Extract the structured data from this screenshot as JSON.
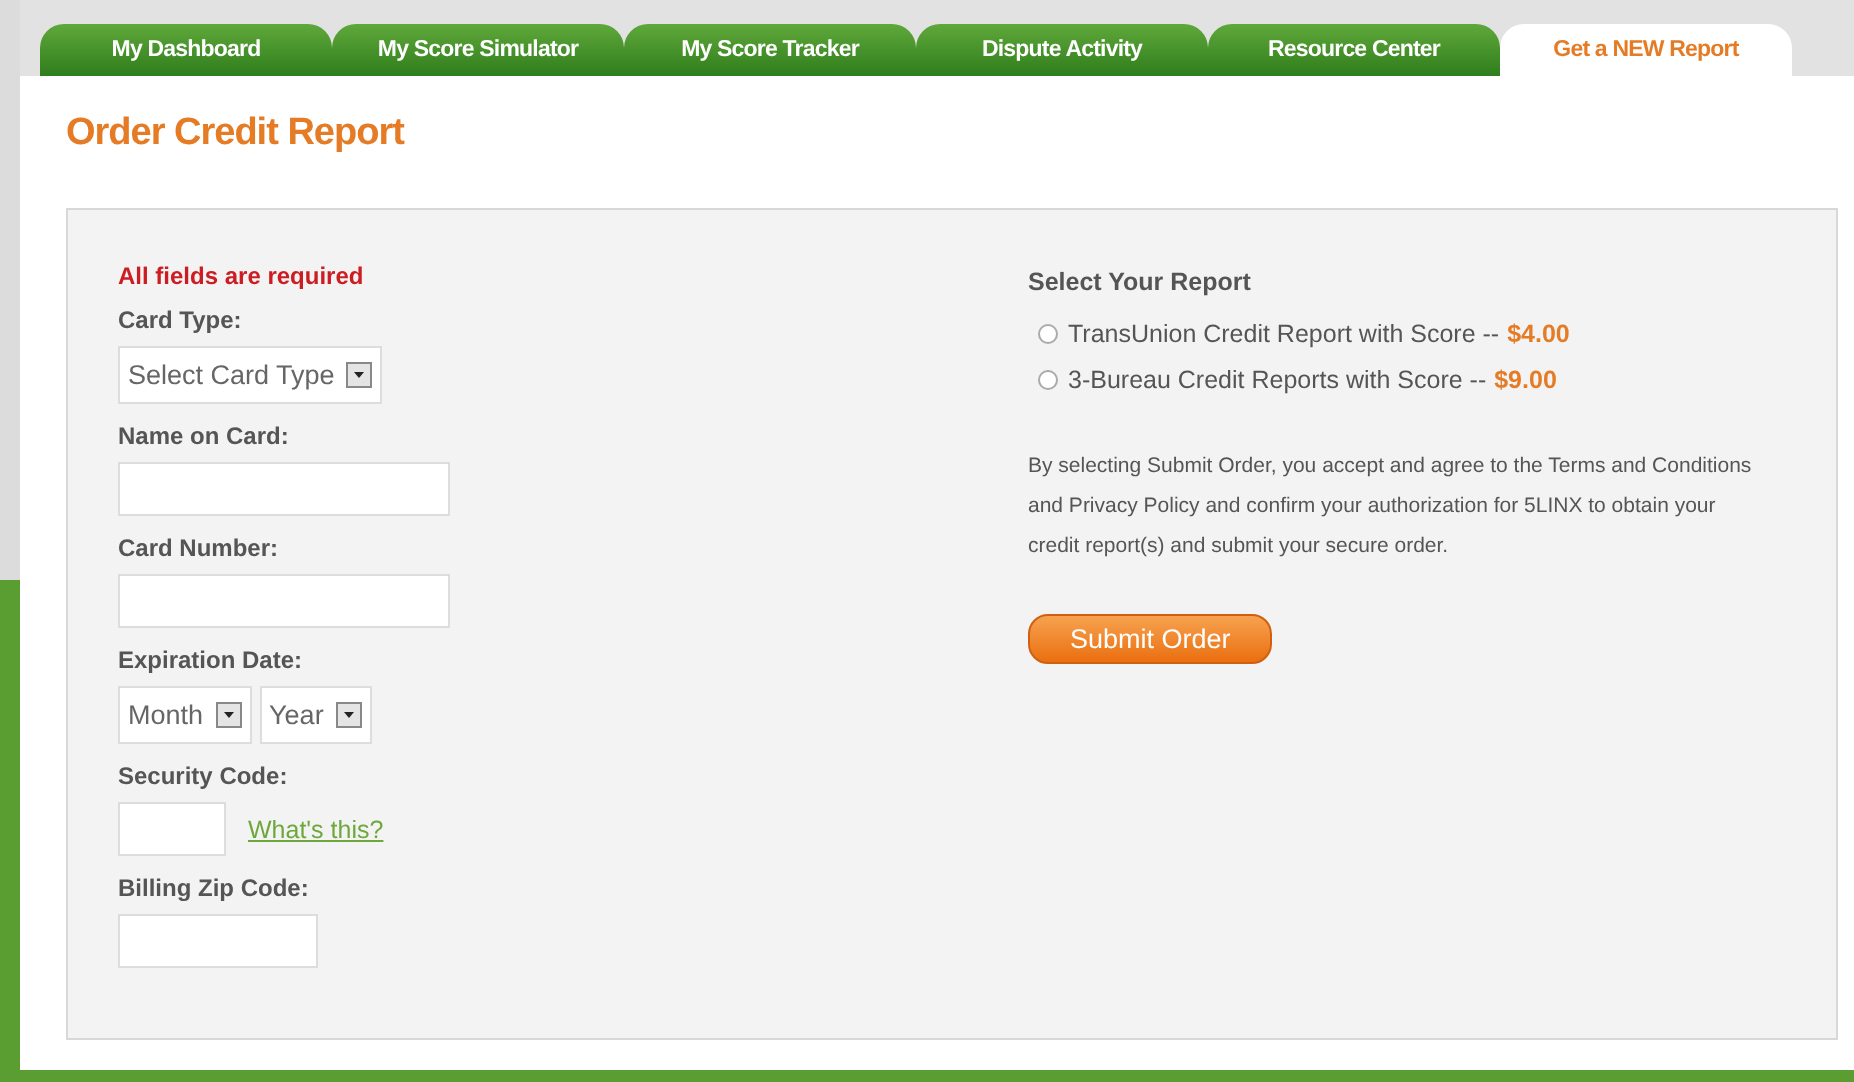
{
  "tabs": [
    {
      "label": "My Dashboard",
      "selected": false
    },
    {
      "label": "My Score Simulator",
      "selected": false
    },
    {
      "label": "My Score Tracker",
      "selected": false
    },
    {
      "label": "Dispute Activity",
      "selected": false
    },
    {
      "label": "Resource Center",
      "selected": false
    },
    {
      "label": "Get a NEW Report",
      "selected": true
    }
  ],
  "page_title": "Order Credit Report",
  "form": {
    "required_note": "All fields are required",
    "fields": [
      {
        "kind": "select",
        "label": "Card Type:",
        "selects": [
          {
            "value": "Select Card Type"
          }
        ]
      },
      {
        "kind": "text",
        "label": "Name on Card:"
      },
      {
        "kind": "text",
        "label": "Card Number:"
      },
      {
        "kind": "select",
        "label": "Expiration Date:",
        "selects": [
          {
            "value": "Month"
          },
          {
            "value": "Year"
          }
        ]
      },
      {
        "kind": "code",
        "label": "Security Code:",
        "link": "What's this?"
      },
      {
        "kind": "zip",
        "label": "Billing Zip Code:"
      }
    ]
  },
  "report": {
    "heading": "Select Your Report",
    "options": [
      {
        "label": "TransUnion Credit Report with Score --",
        "price": "$4.00",
        "selected": false
      },
      {
        "label": "3-Bureau Credit Reports with Score --",
        "price": "$9.00",
        "selected": false
      }
    ],
    "terms": "By selecting Submit Order, you accept and agree to the Terms and Conditions and Privacy Policy and confirm your authorization for 5LINX to obtain your credit report(s) and submit your secure order.",
    "submit": "Submit Order"
  }
}
